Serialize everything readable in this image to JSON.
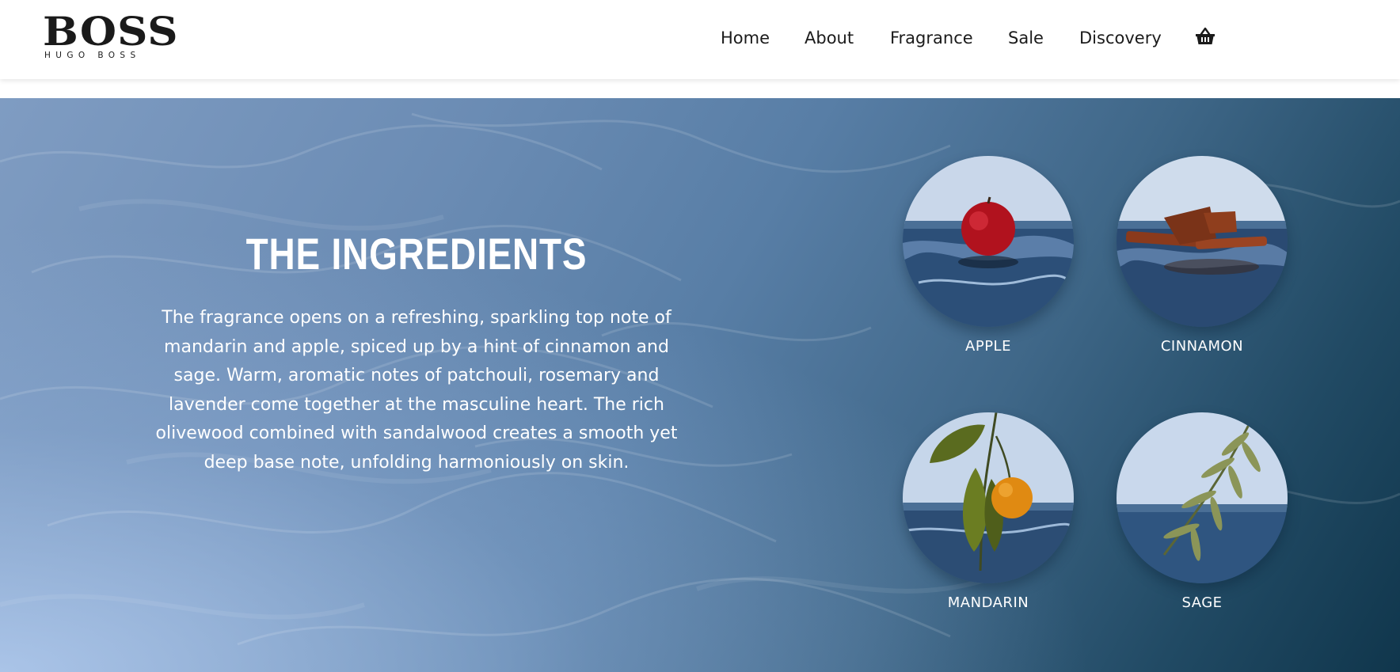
{
  "brand": {
    "name": "BOSS",
    "tagline": "HUGO BOSS"
  },
  "nav": {
    "items": [
      {
        "label": "Home"
      },
      {
        "label": "About"
      },
      {
        "label": "Fragrance"
      },
      {
        "label": "Sale"
      },
      {
        "label": "Discovery"
      }
    ],
    "cart_icon": "basket-icon"
  },
  "hero": {
    "title": "THE INGREDIENTS",
    "text": "The fragrance opens on a refreshing, sparkling top note of mandarin and apple, spiced up by a hint of cinnamon and sage. Warm, aromatic notes of patchouli, rosemary and lavender come together at the masculine heart. The rich olivewood combined with sandalwood creates a smooth yet deep base note, unfolding harmoniously on skin."
  },
  "ingredients": [
    {
      "label": "APPLE",
      "icon": "apple-image"
    },
    {
      "label": "CINNAMON",
      "icon": "cinnamon-image"
    },
    {
      "label": "MANDARIN",
      "icon": "mandarin-image"
    },
    {
      "label": "SAGE",
      "icon": "sage-image"
    }
  ],
  "colors": {
    "nav_text": "#1b1b1b",
    "hero_light": "#7f9cc2",
    "hero_dark": "#10364c",
    "hero_text": "#ffffff"
  }
}
